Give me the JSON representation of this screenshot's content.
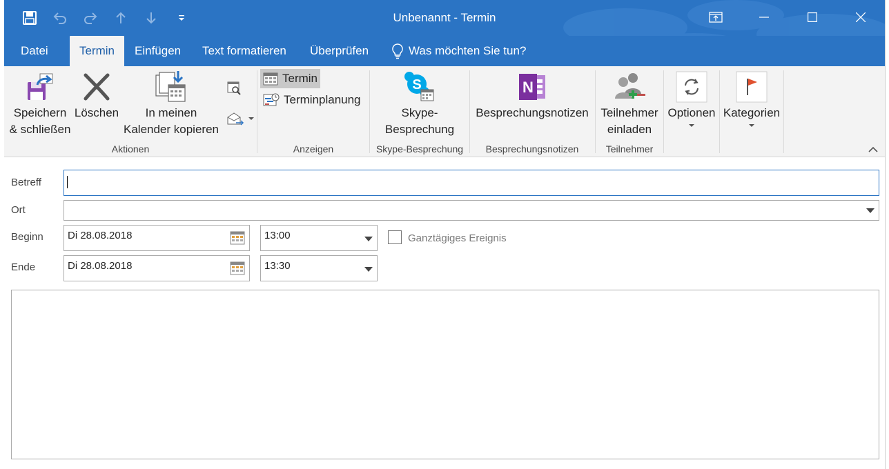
{
  "window": {
    "title": "Unbenannt  -  Termin"
  },
  "colors": {
    "accent": "#2b74c4",
    "ribbon_bg": "#f3f3f3",
    "onenote_purple": "#7b2f9e",
    "skype_blue": "#00a8e8",
    "flag_red": "#e0512f",
    "field_border": "#ababab"
  },
  "quick_access": [
    {
      "icon": "save-icon"
    },
    {
      "icon": "undo-icon"
    },
    {
      "icon": "redo-icon"
    },
    {
      "icon": "arrow-up-icon"
    },
    {
      "icon": "arrow-down-icon"
    },
    {
      "icon": "customize-qat-icon"
    }
  ],
  "window_controls": [
    {
      "icon": "ribbon-display-options-icon"
    },
    {
      "icon": "minimize-icon"
    },
    {
      "icon": "maximize-icon"
    },
    {
      "icon": "close-icon"
    }
  ],
  "tabs": [
    {
      "label": "Datei",
      "active": false
    },
    {
      "label": "Termin",
      "active": true
    },
    {
      "label": "Einfügen",
      "active": false
    },
    {
      "label": "Text formatieren",
      "active": false
    },
    {
      "label": "Überprüfen",
      "active": false
    }
  ],
  "tell_me": {
    "text": "Was möchten Sie tun?",
    "icon": "lightbulb-icon"
  },
  "ribbon": {
    "aktionen": {
      "label": "Aktionen",
      "save_close": {
        "line1": "Speichern",
        "line2": "& schließen",
        "icon": "save-close-icon"
      },
      "delete": {
        "label": "Löschen",
        "icon": "delete-x-icon"
      },
      "copy_calendar": {
        "line1": "In meinen",
        "line2": "Kalender kopieren",
        "icon": "copy-to-calendar-icon"
      },
      "small_icons": [
        "find-calendar-icon",
        "forward-mail-icon"
      ]
    },
    "anzeigen": {
      "label": "Anzeigen",
      "appointment": {
        "label": "Termin",
        "icon": "calendar-icon",
        "selected": true
      },
      "scheduling": {
        "label": "Terminplanung",
        "icon": "scheduling-icon",
        "selected": false
      }
    },
    "skype": {
      "label": "Skype-Besprechung",
      "button": {
        "line1": "Skype-",
        "line2": "Besprechung",
        "icon": "skype-icon"
      }
    },
    "notes": {
      "label": "Besprechungsnotizen",
      "button": {
        "label": "Besprechungsnotizen",
        "icon": "onenote-icon"
      }
    },
    "attendees": {
      "label": "Teilnehmer",
      "button": {
        "line1": "Teilnehmer",
        "line2": "einladen",
        "icon": "invite-attendees-icon"
      }
    },
    "options": {
      "label": "Optionen",
      "icon": "options-sync-icon"
    },
    "categories": {
      "label": "Kategorien",
      "icon": "flag-icon"
    }
  },
  "form": {
    "subject": {
      "label": "Betreff",
      "value": ""
    },
    "location": {
      "label": "Ort",
      "value": ""
    },
    "start": {
      "label": "Beginn",
      "date": "Di 28.08.2018",
      "time": "13:00"
    },
    "end": {
      "label": "Ende",
      "date": "Di 28.08.2018",
      "time": "13:30"
    },
    "all_day": {
      "label": "Ganztägiges Ereignis",
      "checked": false
    },
    "body": ""
  }
}
